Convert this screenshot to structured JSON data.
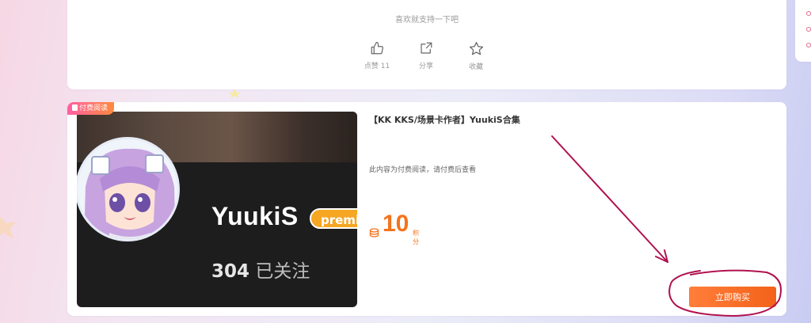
{
  "top": {
    "support_text": "喜欢就支持一下吧",
    "actions": [
      {
        "icon": "thumbs-up-icon",
        "label": "点赞 11"
      },
      {
        "icon": "share-icon",
        "label": "分享"
      },
      {
        "icon": "star-icon",
        "label": "收藏"
      }
    ]
  },
  "post": {
    "badge": "付费阅读",
    "title": "【KK KKS/场景卡作者】YuukiS合集",
    "description": "此内容为付费阅读，请付费后查看",
    "price": "10",
    "price_unit": "积分",
    "buy_label": "立即购买",
    "thumbnail": {
      "username": "YuukiS",
      "tag": "premi",
      "followers": "304",
      "followers_label": "已关注"
    }
  },
  "colors": {
    "accent": "#f4731c",
    "badge_gradient_start": "#ff5fa2",
    "annotation": "#b0124f"
  }
}
